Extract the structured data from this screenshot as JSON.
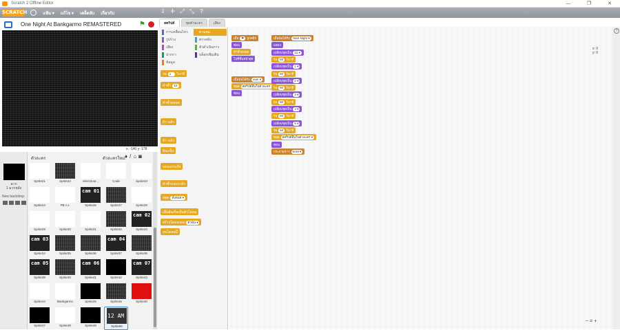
{
  "window": {
    "title": "Scratch 2 Offline Editor",
    "controls": [
      "—",
      "❐",
      "✕"
    ]
  },
  "menubar": {
    "logo": "SCRATCH",
    "items": [
      "แฟ้ม ▾",
      "แก้ไข ▾",
      "เคล็ดลับ",
      "เกี่ยวกับ"
    ],
    "tool_icons": [
      "⇩",
      "✛",
      "⤢",
      "⤡",
      "?"
    ]
  },
  "stage": {
    "project_title": "One Night At Bankgarmo REMASTERED",
    "coords_x": "x: -140",
    "coords_y": "y: 178"
  },
  "sprites_panel": {
    "header_label": "ตัวละคร",
    "new_sprite_label": "ตัวละครใหม่:",
    "stage_label": "ฉาก",
    "stage_sub": "1 ฉากหลัง",
    "new_backdrop_label": "New backdrop:",
    "sprites": [
      {
        "name": "Sprite21",
        "thumb": "white"
      },
      {
        "name": "Sprite22",
        "thumb": "noise"
      },
      {
        "name": "Vent Door...",
        "thumb": "white"
      },
      {
        "name": "Code",
        "thumb": "white"
      },
      {
        "name": "Sprite23",
        "thumb": "white"
      },
      {
        "name": "Sprite24",
        "thumb": "white"
      },
      {
        "name": "PB A.I.",
        "thumb": "white"
      },
      {
        "name": "Sprite26",
        "thumb": "cam",
        "text": "cam 01"
      },
      {
        "name": "Sprite27",
        "thumb": "noise"
      },
      {
        "name": "Sprite28",
        "thumb": "white"
      },
      {
        "name": "Sprite29",
        "thumb": "white"
      },
      {
        "name": "Sprite30",
        "thumb": "white"
      },
      {
        "name": "Sprite31",
        "thumb": "white"
      },
      {
        "name": "Sprite32",
        "thumb": "noise"
      },
      {
        "name": "Sprite33",
        "thumb": "cam",
        "text": "cam 02"
      },
      {
        "name": "Sprite34",
        "thumb": "cam",
        "text": "cam 03"
      },
      {
        "name": "Sprite35",
        "thumb": "noise"
      },
      {
        "name": "Sprite36",
        "thumb": "noise"
      },
      {
        "name": "Sprite37",
        "thumb": "cam",
        "text": "cam 04"
      },
      {
        "name": "Sprite38",
        "thumb": "noise"
      },
      {
        "name": "Sprite39",
        "thumb": "cam",
        "text": "cam 05"
      },
      {
        "name": "Sprite40",
        "thumb": "noise"
      },
      {
        "name": "Sprite41",
        "thumb": "cam",
        "text": "cam 06"
      },
      {
        "name": "Sprite42",
        "thumb": "black"
      },
      {
        "name": "Sprite43",
        "thumb": "cam",
        "text": "cam 07"
      },
      {
        "name": "Sprite44",
        "thumb": "white"
      },
      {
        "name": "Bankgarmo",
        "thumb": "white"
      },
      {
        "name": "Sprite25",
        "thumb": "black"
      },
      {
        "name": "Sprite45",
        "thumb": "noise"
      },
      {
        "name": "Sprite46",
        "thumb": "red"
      },
      {
        "name": "Sprite47",
        "thumb": "black"
      },
      {
        "name": "Sprite48",
        "thumb": "white"
      },
      {
        "name": "Sprite49",
        "thumb": "black"
      },
      {
        "name": "Sprite50",
        "thumb": "text",
        "text": "12 AM",
        "selected": true
      }
    ]
  },
  "tabs": [
    "สคริปต์",
    "ชุดตัวละคร",
    "เสียง"
  ],
  "categories": [
    {
      "label": "การเคลื่อนไหว",
      "color": "#4a6cd4"
    },
    {
      "label": "ควบคุม",
      "color": "#e6a822",
      "active": true
    },
    {
      "label": "รูปร่าง",
      "color": "#8a55d7"
    },
    {
      "label": "ตรวจจับ",
      "color": "#2ca5e2"
    },
    {
      "label": "เสียง",
      "color": "#bb42c3"
    },
    {
      "label": "ตัวดำเนินการ",
      "color": "#5cb712"
    },
    {
      "label": "ปากกา",
      "color": "#0e9a6c"
    },
    {
      "label": "บล็อกเพิ่มเติม",
      "color": "#632d99"
    },
    {
      "label": "ข้อมูล",
      "color": "#ee7d16"
    }
  ],
  "palette_blocks": [
    {
      "label": "รอ",
      "input": "1",
      "suffix": "วินาที"
    },
    {
      "label": "ทำซ้ำ",
      "input": "10"
    },
    {
      "label": "ทำซ้ำตลอด"
    },
    {
      "label": "ถ้า",
      "suffix": "แล้ว"
    },
    {
      "label": "ถ้า",
      "suffix": "แล้ว"
    },
    {
      "label": "มิฉะนั้น"
    },
    {
      "label": "รอจนกระทั่ง"
    },
    {
      "label": "ทำซ้ำจนกระทั่ง"
    },
    {
      "label": "หยุด",
      "input": "ทั้งหมด ▾"
    },
    {
      "label": "เมื่อฉันเริ่มเป็นตัวโคลน"
    },
    {
      "label": "สร้างโคลนของ",
      "input": "ตัวฉัน ▾"
    },
    {
      "label": "ลบโคลนนี้"
    }
  ],
  "scripts": {
    "script1": [
      {
        "text": "เมื่อ",
        "input": "⚑",
        "suffix": "ถูกคลิก",
        "cat": "evt"
      },
      {
        "text": "ซ่อน",
        "cat": "lks"
      },
      {
        "text": "ทำซ้ำตลอด",
        "cat": "ctrl"
      },
      {
        "text": "ไปที่ชั้นหน้าสุด",
        "cat": "lks"
      }
    ],
    "script2": [
      {
        "text": "เมื่อฉันได้รับ",
        "input": "over ▾",
        "cat": "evt"
      },
      {
        "text": "หยุด",
        "input": "สคริปต์อื่นในตัวละคร ▾",
        "cat": "ctrl"
      },
      {
        "text": "ซ่อน",
        "cat": "lks"
      }
    ],
    "script3": [
      {
        "text": "เมื่อฉันได้รับ",
        "input": "Start Night ▾",
        "cat": "evt"
      },
      {
        "text": "แสดง",
        "cat": "lks"
      },
      {
        "text": "เปลี่ยนชุดเป็น",
        "input": "12 ▾",
        "cat": "lks"
      },
      {
        "text": "รอ",
        "input": "60",
        "suffix": "วินาที",
        "cat": "ctrl"
      },
      {
        "text": "เปลี่ยนชุดเป็น",
        "input": "1 ▾",
        "cat": "lks"
      },
      {
        "text": "รอ",
        "input": "60",
        "suffix": "วินาที",
        "cat": "ctrl"
      },
      {
        "text": "เปลี่ยนชุดเป็น",
        "input": "2 ▾",
        "cat": "lks"
      },
      {
        "text": "รอ",
        "input": "60",
        "suffix": "วินาที",
        "cat": "ctrl"
      },
      {
        "text": "เปลี่ยนชุดเป็น",
        "input": "3 ▾",
        "cat": "lks"
      },
      {
        "text": "รอ",
        "input": "60",
        "suffix": "วินาที",
        "cat": "ctrl"
      },
      {
        "text": "เปลี่ยนชุดเป็น",
        "input": "4 ▾",
        "cat": "lks"
      },
      {
        "text": "รอ",
        "input": "60",
        "suffix": "วินาที",
        "cat": "ctrl"
      },
      {
        "text": "เปลี่ยนชุดเป็น",
        "input": "5 ▾",
        "cat": "lks"
      },
      {
        "text": "รอ",
        "input": "60",
        "suffix": "วินาที",
        "cat": "ctrl"
      },
      {
        "text": "หยุด",
        "input": "สคริปต์อื่นในตัวละคร ▾",
        "cat": "ctrl"
      },
      {
        "text": "ซ่อน",
        "cat": "lks"
      },
      {
        "text": "กระจายข่าว",
        "input": "6AM ▾",
        "cat": "evt"
      }
    ]
  },
  "sprite_info": {
    "x": "x: 0",
    "y": "y: 0"
  },
  "zoom": [
    "−",
    "=",
    "+"
  ]
}
